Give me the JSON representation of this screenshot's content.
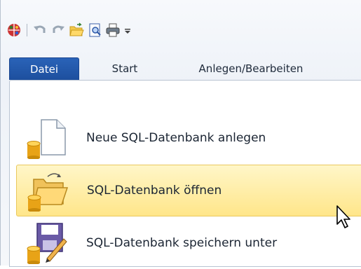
{
  "quick_access_toolbar": {
    "icons": [
      "app-globe-icon",
      "undo-icon",
      "redo-icon",
      "open-folder-icon",
      "print-preview-icon",
      "print-icon",
      "customize-dropdown-icon"
    ]
  },
  "ribbon": {
    "tabs": [
      {
        "label": "Datei",
        "active": true
      },
      {
        "label": "Start",
        "active": false
      },
      {
        "label": "Anlegen/Bearbeiten",
        "active": false
      }
    ]
  },
  "backstage_menu": {
    "items": [
      {
        "label": "Neue SQL-Datenbank anlegen",
        "icon": "new-database-icon",
        "hovered": false
      },
      {
        "label": "SQL-Datenbank öffnen",
        "icon": "open-database-icon",
        "hovered": true
      },
      {
        "label": "SQL-Datenbank speichern unter",
        "icon": "save-database-as-icon",
        "hovered": false
      }
    ]
  },
  "colors": {
    "file_tab": "#1d4f9e",
    "hover_highlight": "#ffe68a",
    "database_cylinder": "#e8a317"
  }
}
